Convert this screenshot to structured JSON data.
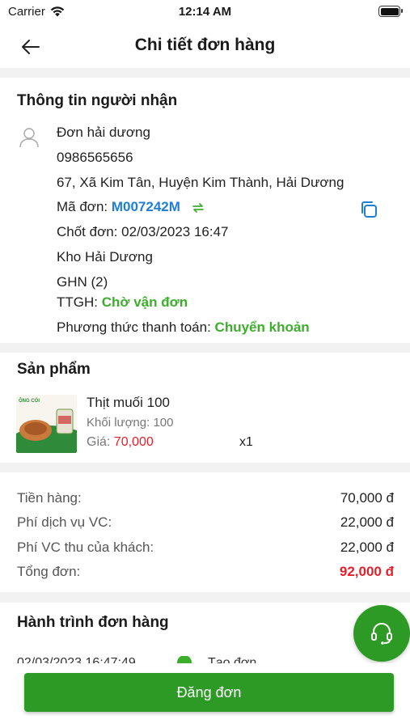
{
  "status_bar": {
    "carrier": "Carrier",
    "time": "12:14 AM"
  },
  "header": {
    "title": "Chi tiết đơn hàng"
  },
  "recipient": {
    "section_title": "Thông tin người nhận",
    "name": "Đơn hải dương",
    "phone": "0986565656",
    "address": "67, Xã Kim Tân, Huyện Kim Thành, Hải Dương",
    "order_code_label": "Mã đơn:",
    "order_code": "M007242M",
    "closed_label": "Chốt đơn:",
    "closed_at": "02/03/2023 16:47",
    "warehouse": "Kho Hải Dương",
    "carrier": "GHN (2)",
    "shipping_status_label": "TTGH:",
    "shipping_status": "Chờ vận đơn",
    "payment_label": "Phương thức thanh toán:",
    "payment_method": "Chuyển khoản"
  },
  "products": {
    "section_title": "Sản phẩm",
    "items": [
      {
        "name": "Thịt muối 100",
        "weight_label": "Khối lượng:",
        "weight": "100",
        "price_label": "Giá:",
        "price": "70,000",
        "quantity": "x1",
        "image_brand": "ÔNG CÓI"
      }
    ]
  },
  "summary": {
    "rows": [
      {
        "label": "Tiền hàng:",
        "value": "70,000 đ"
      },
      {
        "label": "Phí dịch vụ VC:",
        "value": "22,000 đ"
      },
      {
        "label": "Phí VC thu của khách:",
        "value": "22,000 đ"
      },
      {
        "label": "Tổng đơn:",
        "value": "92,000 đ"
      }
    ]
  },
  "journey": {
    "section_title": "Hành trình đơn hàng",
    "events": [
      {
        "time": "02/03/2023 16:47:49",
        "label": "Tạo đơn"
      }
    ]
  },
  "footer": {
    "submit_label": "Đăng đơn"
  },
  "colors": {
    "primary_green": "#2e9a26",
    "link_blue": "#1f7fd4",
    "status_green": "#3cae2c",
    "price_red": "#e5202a"
  },
  "icons": [
    "wifi-icon",
    "battery-icon",
    "back-arrow-icon",
    "user-icon",
    "sync-icon",
    "copy-icon",
    "check-circle-icon",
    "headset-icon"
  ]
}
